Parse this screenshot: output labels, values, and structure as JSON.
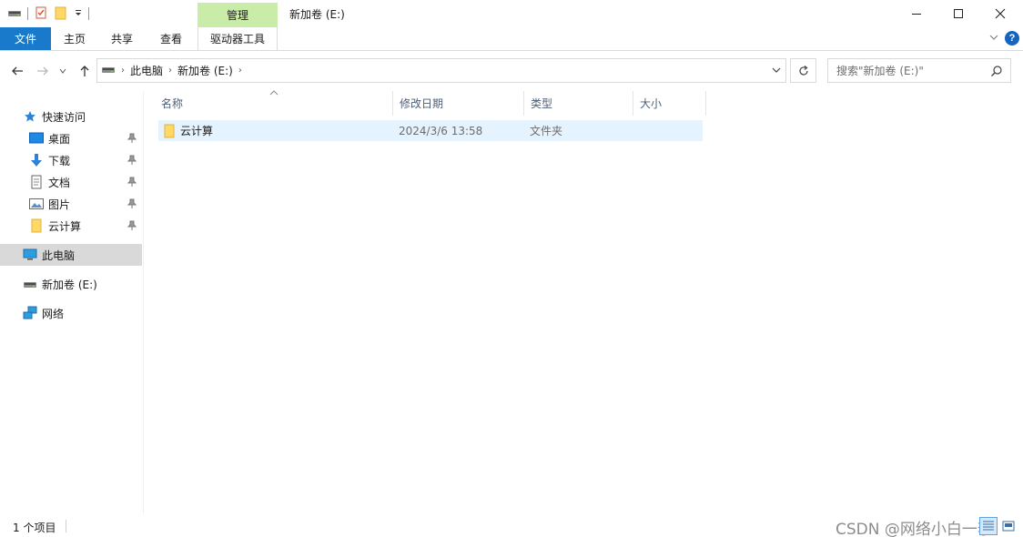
{
  "window": {
    "title": "新加卷 (E:)",
    "context_tab_label": "管理"
  },
  "ribbon": {
    "tabs": [
      "文件",
      "主页",
      "共享",
      "查看",
      "驱动器工具"
    ]
  },
  "address": {
    "crumbs": [
      "此电脑",
      "新加卷 (E:)"
    ]
  },
  "search": {
    "placeholder": "搜索\"新加卷 (E:)\""
  },
  "sidebar": {
    "quick_access": "快速访问",
    "pinned": [
      "桌面",
      "下载",
      "文档",
      "图片",
      "云计算"
    ],
    "this_pc": "此电脑",
    "drive": "新加卷 (E:)",
    "network": "网络"
  },
  "columns": [
    "名称",
    "修改日期",
    "类型",
    "大小"
  ],
  "files": [
    {
      "name": "云计算",
      "modified": "2024/3/6 13:58",
      "type": "文件夹",
      "size": ""
    }
  ],
  "status": {
    "item_count": "1 个项目"
  },
  "watermark": "CSDN @网络小白一李",
  "colors": {
    "file_tab": "#1979ca",
    "context_tab": "#c9eca9",
    "selection": "#e5f3ff",
    "sidebar_selected": "#d9d9d9",
    "column_header_text": "#4c607a"
  }
}
